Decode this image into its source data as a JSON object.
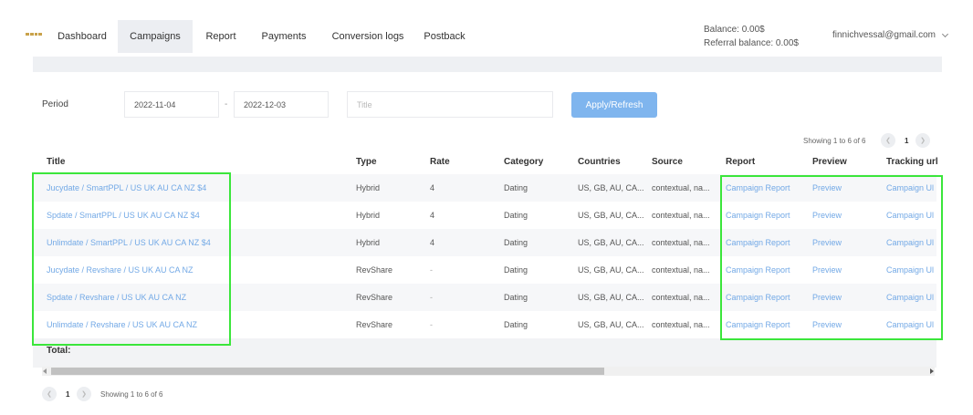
{
  "nav": {
    "items": [
      {
        "label": "Dashboard",
        "active": false
      },
      {
        "label": "Campaigns",
        "active": true
      },
      {
        "label": "Report",
        "active": false
      },
      {
        "label": "Payments",
        "active": false
      },
      {
        "label": "Conversion logs",
        "active": false
      },
      {
        "label": "Postback",
        "active": false
      }
    ],
    "balance": "Balance: 0.00$",
    "referral_balance": "Referral balance: 0.00$",
    "user_email": "finnichvessal@gmail.com"
  },
  "filters": {
    "period_label": "Period",
    "date_from": "2022-11-04",
    "separator": "-",
    "date_to": "2022-12-03",
    "title_placeholder": "Title",
    "apply_label": "Apply/Refresh"
  },
  "pager": {
    "showing": "Showing 1 to 6 of 6",
    "current_page": "1",
    "prev_icon": "chevron-left-icon",
    "next_icon": "chevron-right-icon"
  },
  "table": {
    "columns": [
      "Title",
      "Type",
      "Rate",
      "Category",
      "Countries",
      "Source",
      "Report",
      "Preview",
      "Tracking url"
    ],
    "rows": [
      {
        "title": "Jucydate / SmartPPL / US UK AU CA NZ $4",
        "type": "Hybrid",
        "rate": "4",
        "category": "Dating",
        "countries": "US, GB, AU, CA...",
        "source": "contextual, na...",
        "report": "Campaign Report",
        "preview": "Preview",
        "tracking": "Campaign Ul"
      },
      {
        "title": "Spdate / SmartPPL / US UK AU CA NZ $4",
        "type": "Hybrid",
        "rate": "4",
        "category": "Dating",
        "countries": "US, GB, AU, CA...",
        "source": "contextual, na...",
        "report": "Campaign Report",
        "preview": "Preview",
        "tracking": "Campaign Ul"
      },
      {
        "title": "Unlimdate / SmartPPL / US UK AU CA NZ $4",
        "type": "Hybrid",
        "rate": "4",
        "category": "Dating",
        "countries": "US, GB, AU, CA...",
        "source": "contextual, na...",
        "report": "Campaign Report",
        "preview": "Preview",
        "tracking": "Campaign Ul"
      },
      {
        "title": "Jucydate / Revshare / US UK AU CA NZ",
        "type": "RevShare",
        "rate": "-",
        "category": "Dating",
        "countries": "US, GB, AU, CA...",
        "source": "contextual, na...",
        "report": "Campaign Report",
        "preview": "Preview",
        "tracking": "Campaign Ul"
      },
      {
        "title": "Spdate / Revshare / US UK AU CA NZ",
        "type": "RevShare",
        "rate": "-",
        "category": "Dating",
        "countries": "US, GB, AU, CA...",
        "source": "contextual, na...",
        "report": "Campaign Report",
        "preview": "Preview",
        "tracking": "Campaign Ul"
      },
      {
        "title": "Unlimdate / Revshare / US UK AU CA NZ",
        "type": "RevShare",
        "rate": "-",
        "category": "Dating",
        "countries": "US, GB, AU, CA...",
        "source": "contextual, na...",
        "report": "Campaign Report",
        "preview": "Preview",
        "tracking": "Campaign Ul"
      }
    ],
    "total_label": "Total:"
  },
  "colors": {
    "accent": "#7fb5ee",
    "link": "#73a9e6",
    "highlight": "#3be63b"
  }
}
